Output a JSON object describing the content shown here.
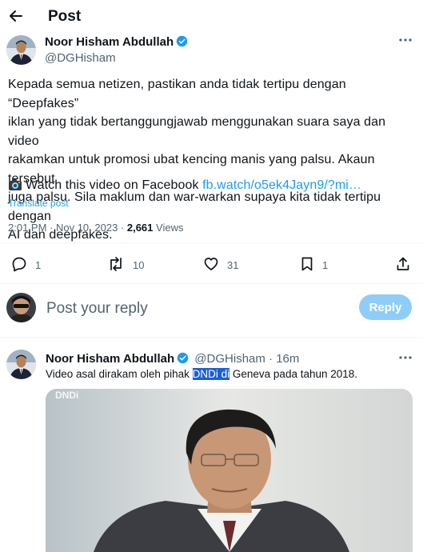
{
  "header": {
    "title": "Post"
  },
  "tweet": {
    "author_name": "Noor Hisham Abdullah",
    "author_handle": "@DGHisham",
    "lines": [
      "Kepada semua netizen, pastikan anda tidak tertipu dengan “Deepfakes”",
      "iklan yang tidak bertanggungjawab menggunakan suara saya dan video",
      "rakamkan untuk promosi ubat kencing manis yang palsu. Akaun tersebut",
      "juga palsu. Sila maklum dan war-warkan supaya kita tidak tertipu dengan",
      "AI dan deepfakes."
    ],
    "watch_text": "Watch this video on Facebook",
    "watch_link": "fb.watch/o5ek4Jayn9/?mi…",
    "translate": "Translate post",
    "timestamp": "2:01 PM · Nov 10, 2023 · ",
    "views_count": "2,661",
    "views_label": " Views",
    "actions": {
      "replies": "1",
      "reposts": "10",
      "likes": "31",
      "bookmarks": "1"
    }
  },
  "composer": {
    "placeholder": "Post your reply",
    "button": "Reply"
  },
  "reply": {
    "author_name": "Noor Hisham Abdullah",
    "handle_time": "@DGHisham · 16m",
    "text_before": "Video asal dirakam oleh pihak ",
    "text_highlight": "DNDi di",
    "text_after": " Geneva pada tahun 2018.",
    "image_watermark": "DNDi"
  },
  "colors": {
    "accent": "#1d9bf0",
    "reply_button": "#8ecdf8",
    "highlight": "#1b5fd6"
  }
}
